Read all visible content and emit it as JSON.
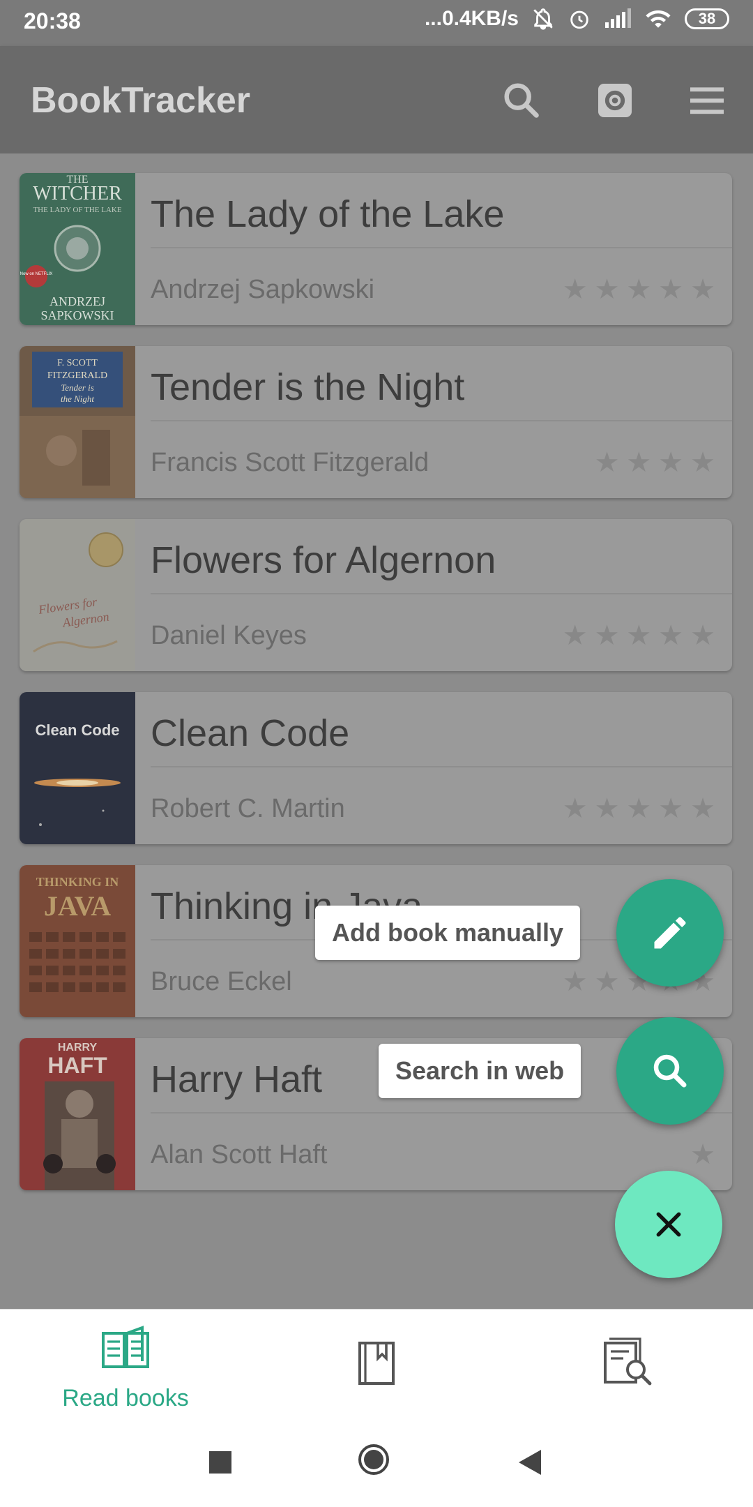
{
  "status_bar": {
    "time": "20:38",
    "network_speed": "...0.4KB/s",
    "battery": "38"
  },
  "app_bar": {
    "title": "BookTracker",
    "icons": [
      "search-icon",
      "settings-icon",
      "menu-icon"
    ]
  },
  "books": [
    {
      "title": "The Lady of the Lake",
      "author": "Andrzej Sapkowski",
      "stars": 5
    },
    {
      "title": "Tender is the Night",
      "author": "Francis Scott Fitzgerald",
      "stars": 4
    },
    {
      "title": "Flowers for Algernon",
      "author": "Daniel Keyes",
      "stars": 5
    },
    {
      "title": "Clean Code",
      "author": "Robert C. Martin",
      "stars": 5
    },
    {
      "title": "Thinking in Java",
      "author": "Bruce Eckel",
      "stars": 5
    },
    {
      "title": "Harry Haft",
      "author": "Alan Scott Haft",
      "stars": 1
    }
  ],
  "covers": {
    "witcher": {
      "line1": "THE",
      "line2": "WITCHER",
      "line3": "THE LADY OF THE LAKE",
      "badge": "Now on NETFLIX",
      "author1": "ANDRZEJ",
      "author2": "SAPKOWSKI"
    },
    "tender": {
      "line1": "F. SCOTT",
      "line2": "FITZGERALD",
      "line3": "Tender is",
      "line4": "the Night"
    },
    "flowers": {
      "line1": "Flowers for",
      "line2": "Algernon"
    },
    "clean": {
      "line1": "Clean Code"
    },
    "java": {
      "line1": "THINKING IN",
      "line2": "JAVA"
    },
    "harry": {
      "line1": "HARRY",
      "line2": "HAFT"
    }
  },
  "fab_actions": {
    "add_manually": "Add book manually",
    "search_web": "Search in web"
  },
  "bottom_nav": {
    "read_books_label": "Read books"
  },
  "colors": {
    "accent": "#2ba886",
    "fab_main": "#6ee8c0"
  }
}
